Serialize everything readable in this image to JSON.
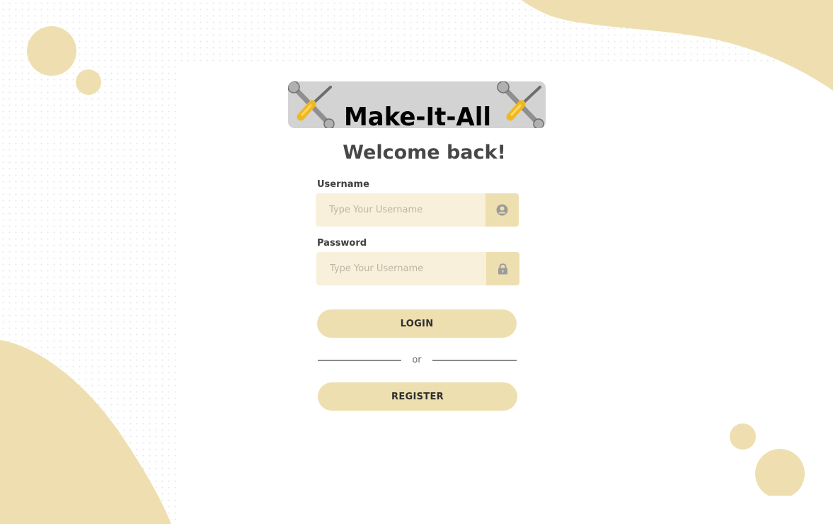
{
  "brand": {
    "logo_text": "Make-It-All"
  },
  "heading": "Welcome back!",
  "username": {
    "label": "Username",
    "placeholder": "Type Your Username",
    "icon": "user-circle-icon"
  },
  "password": {
    "label": "Password",
    "placeholder": "Type Your Username",
    "icon": "lock-icon"
  },
  "login_button": "LOGIN",
  "separator": "or",
  "register_button": "REGISTER",
  "colors": {
    "accent": "#eedfb1",
    "input_background": "#f8f0da",
    "heading": "#474747",
    "logo_background": "#d3d3d3"
  }
}
